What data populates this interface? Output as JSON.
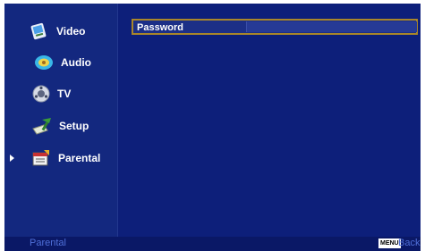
{
  "sidebar": {
    "items": [
      {
        "label": "Video",
        "icon": "video-icon",
        "selected": false
      },
      {
        "label": "Audio",
        "icon": "audio-icon",
        "selected": false
      },
      {
        "label": "TV",
        "icon": "tv-icon",
        "selected": false
      },
      {
        "label": "Setup",
        "icon": "setup-icon",
        "selected": false
      },
      {
        "label": "Parental",
        "icon": "parental-icon",
        "selected": true
      }
    ]
  },
  "main": {
    "password_label": "Password",
    "password_value": ""
  },
  "footer": {
    "title": "Parental",
    "menu_key": "MENU",
    "back_label": "Back"
  },
  "colors": {
    "background": "#0d1f7a",
    "sidebar": "#13287f",
    "highlight_border": "#a8862a",
    "footer_text": "#4f6fd8"
  }
}
